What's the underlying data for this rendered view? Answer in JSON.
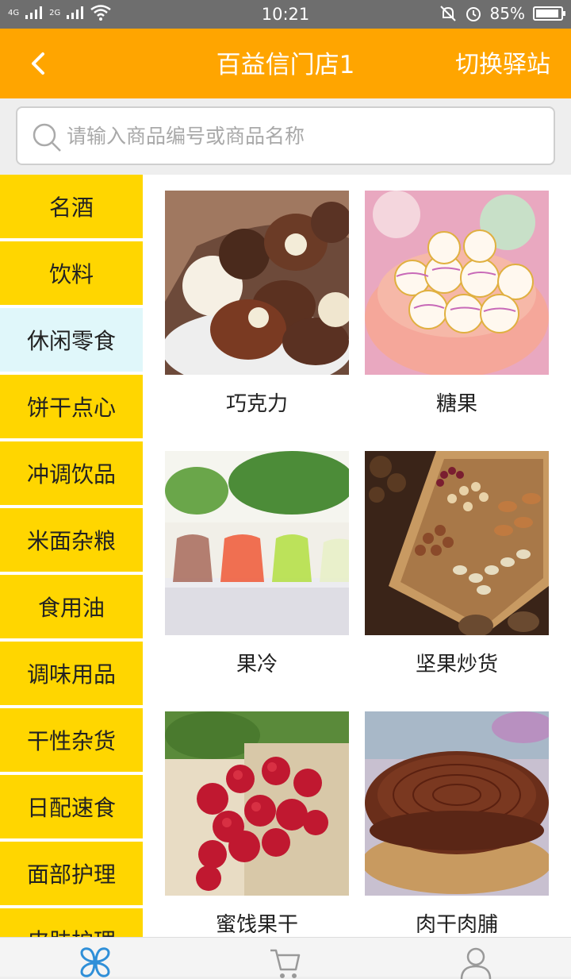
{
  "status_bar": {
    "signal_1": "4G",
    "signal_2": "2G",
    "time": "10:21",
    "battery": "85%"
  },
  "header": {
    "title": "百益信门店1",
    "switch_label": "切换驿站"
  },
  "search": {
    "placeholder": "请输入商品编号或商品名称"
  },
  "sidebar": {
    "items": [
      {
        "label": "名酒"
      },
      {
        "label": "饮料"
      },
      {
        "label": "休闲零食"
      },
      {
        "label": "饼干点心"
      },
      {
        "label": "冲调饮品"
      },
      {
        "label": "米面杂粮"
      },
      {
        "label": "食用油"
      },
      {
        "label": "调味用品"
      },
      {
        "label": "干性杂货"
      },
      {
        "label": "日配速食"
      },
      {
        "label": "面部护理"
      },
      {
        "label": "皮肤护理"
      }
    ],
    "active_label": "休闲零食"
  },
  "products": [
    {
      "label": "巧克力",
      "image": "chocolate"
    },
    {
      "label": "糖果",
      "image": "candy"
    },
    {
      "label": "果冷",
      "image": "jelly"
    },
    {
      "label": "坚果炒货",
      "image": "nuts"
    },
    {
      "label": "蜜饯果干",
      "image": "dried-fruit"
    },
    {
      "label": "肉干肉脯",
      "image": "jerky"
    }
  ],
  "tabbar": {
    "tabs": [
      {
        "icon": "category-icon"
      },
      {
        "icon": "cart-icon"
      },
      {
        "icon": "user-icon"
      }
    ]
  },
  "colors": {
    "header": "#ffa500",
    "sidebar": "#ffd600",
    "sidebar_active": "#e0f7fa",
    "accent_blue": "#2f8fd8"
  }
}
